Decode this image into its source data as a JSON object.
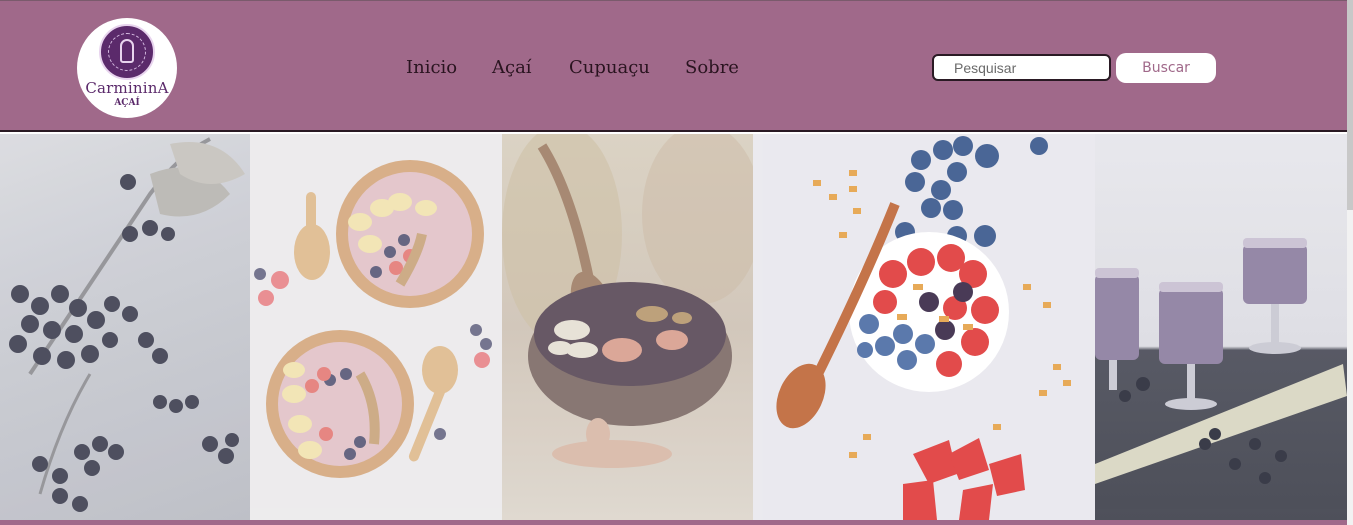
{
  "brand": {
    "name": "CarmininA",
    "sub": "AÇAÍ"
  },
  "nav": {
    "items": [
      "Inicio",
      "Açaí",
      "Cupuaçu",
      "Sobre"
    ]
  },
  "search": {
    "placeholder": "Pesquisar",
    "button_label": "Buscar"
  },
  "gallery": {
    "images": [
      "berries-branch-image",
      "acai-bowls-spoons-image",
      "acai-bowl-hand-image",
      "berries-bowl-topdown-image",
      "acai-smoothie-glasses-image"
    ]
  },
  "colors": {
    "header": "#a0698a",
    "brand_purple": "#5b2a6b",
    "button_text": "#a0698a"
  }
}
